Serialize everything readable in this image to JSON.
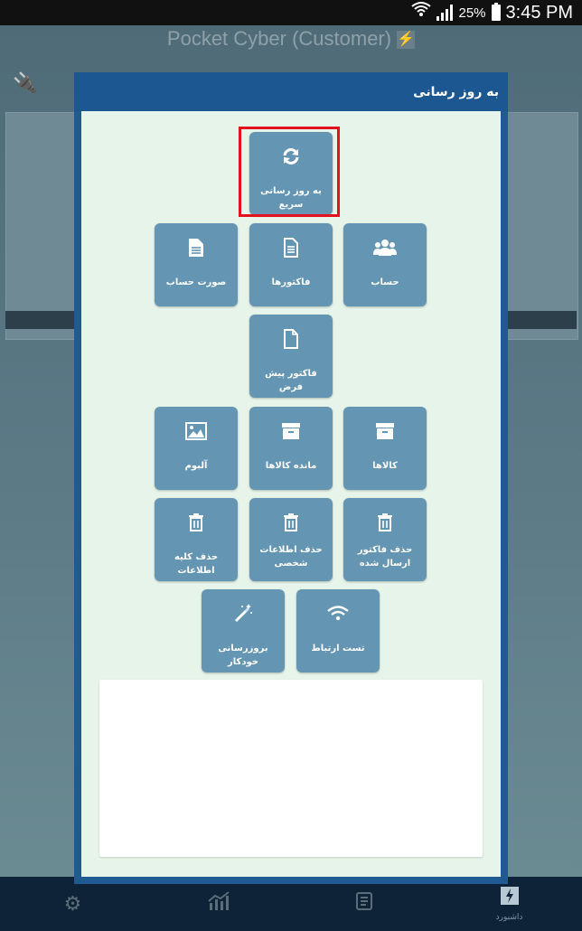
{
  "status_bar": {
    "battery": "25%",
    "time": "3:45 PM"
  },
  "app": {
    "title": "Pocket Cyber (Customer)"
  },
  "dialog": {
    "title": "به روز رسانی"
  },
  "tiles": {
    "quick_update": "به روز رسانی سریع",
    "account": "حساب",
    "invoices": "فاکتورها",
    "statement": "صورت حساب",
    "proforma": "فاکتور پیش فرض",
    "products": "کالاها",
    "product_stock": "مانده کالاها",
    "album": "آلبوم",
    "delete_sent_invoice": "حذف فاکتور ارسال شده",
    "delete_personal_info": "حذف اطلاعات شخصی",
    "delete_all_info": "حذف کلیه اطلاعات",
    "connection_test": "تست ارتباط",
    "auto_update": "بروزرسانی خودکار"
  },
  "bottom_nav": {
    "dashboard_label": "داشبورد"
  },
  "colors": {
    "tile": "#6496b4",
    "dialog_header": "#1d5792",
    "dialog_body": "#e7f4ea",
    "highlight": "#e3111e"
  }
}
